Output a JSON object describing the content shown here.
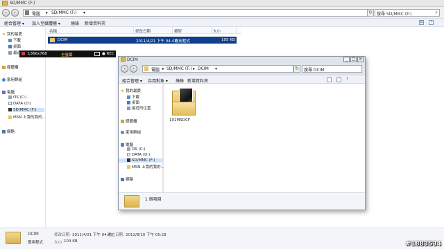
{
  "outer": {
    "title": "SD/MMC (F:)",
    "address": [
      "電腦",
      "SD/MMC (F:)"
    ],
    "search_placeholder": "搜尋 SD/MMC (F:)",
    "toolbar": [
      "組合管理 ▾",
      "加入至媒體櫃 ▾",
      "燒錄",
      "新增資料夾"
    ],
    "sidebar": {
      "favorites": "我的最愛",
      "fav_items": [
        "下載",
        "桌面",
        "最近的位置"
      ],
      "libraries": "媒體櫃",
      "homegroup": "家用群組",
      "computer": "電腦",
      "drives": [
        "OS (C:)",
        "DATA (D:)",
        "SD/MMC (F:)",
        "MSN 上我的我的..."
      ],
      "network": "網路"
    },
    "columns": [
      "名稱",
      "修改日期",
      "類型",
      "大小"
    ],
    "file": {
      "name": "DCIM",
      "date": "2011/4/21 下午 04:43",
      "type": "應用程式",
      "size": "105 KB"
    },
    "overlay": {
      "res": "1366x768",
      "label": "全螢幕",
      "rec": "● REC"
    },
    "status": {
      "name": "DCIM",
      "modified_label": "修改日期:",
      "modified": "2011/4/21 下午 04:43",
      "created_label": "建立日期:",
      "created": "2012/8/10 下午 05:28",
      "type": "應用程式",
      "size_label": "大小:",
      "size": "104 KB"
    },
    "watermark": "#1883534"
  },
  "inner": {
    "title": "DCIM",
    "address": [
      "電腦",
      "SD/MMC (F:)",
      "DCIM"
    ],
    "search_placeholder": "搜尋 DCIM",
    "toolbar": [
      "組合管理 ▾",
      "共用對象 ▾",
      "燒錄",
      "新增資料夾"
    ],
    "sidebar": {
      "favorites": "我的最愛",
      "fav_items": [
        "下載",
        "桌面",
        "最近的位置"
      ],
      "libraries": "媒體櫃",
      "homegroup": "家用群組",
      "computer": "電腦",
      "drives": [
        "OS (C:)",
        "DATA (D:)",
        "SD/MMC (F:)",
        "MSN 上我的我的..."
      ],
      "network": "網路"
    },
    "folder": "101MSDCF",
    "status": "1 個項目"
  },
  "colors": {
    "selection": "#0e3e8c",
    "folder": "#e8c56a"
  }
}
